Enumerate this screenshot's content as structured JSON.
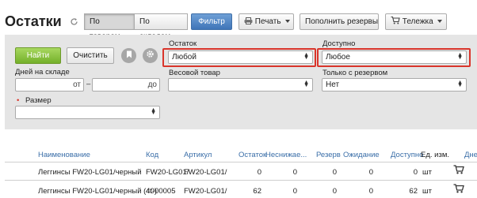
{
  "header": {
    "title": "Остатки",
    "view_by_products": "По товарам",
    "view_by_warehouses": "По складам",
    "filter": "Фильтр",
    "print": "Печать",
    "replenish": "Пополнить резервы",
    "cart": "Тележка"
  },
  "filters": {
    "find": "Найти",
    "clear": "Очистить",
    "days_label": "Дней на складе",
    "from_placeholder": "от",
    "dash": "–",
    "to_placeholder": "до",
    "size_label": "Размер",
    "size_marker": "•",
    "stock_label": "Остаток",
    "stock_value": "Любой",
    "weight_label": "Весовой товар",
    "weight_value": "",
    "available_label": "Доступно",
    "available_value": "Любое",
    "reserve_label": "Только с резервом",
    "reserve_value": "Нет"
  },
  "table": {
    "headers": {
      "name": "Наименование",
      "code": "Код",
      "article": "Артикул",
      "stock": "Остаток",
      "nonreduced": "Неснижае...",
      "reserve": "Резерв",
      "waiting": "Ожидание",
      "available": "Доступно",
      "unit": "Ед. изм.",
      "days": "Дне"
    },
    "rows": [
      {
        "name": "Леггинсы FW20-LG01/черный",
        "code": "FW20-LG01/",
        "article": "FW20-LG01/",
        "stock": "0",
        "nonreduced": "0",
        "reserve": "0",
        "waiting": "0",
        "available": "0",
        "unit": "шт"
      },
      {
        "name": "Леггинсы FW20-LG01/черный (40)",
        "code": "4t-00005",
        "article": "FW20-LG01/",
        "stock": "62",
        "nonreduced": "0",
        "reserve": "0",
        "waiting": "0",
        "available": "62",
        "unit": "шт"
      }
    ]
  }
}
